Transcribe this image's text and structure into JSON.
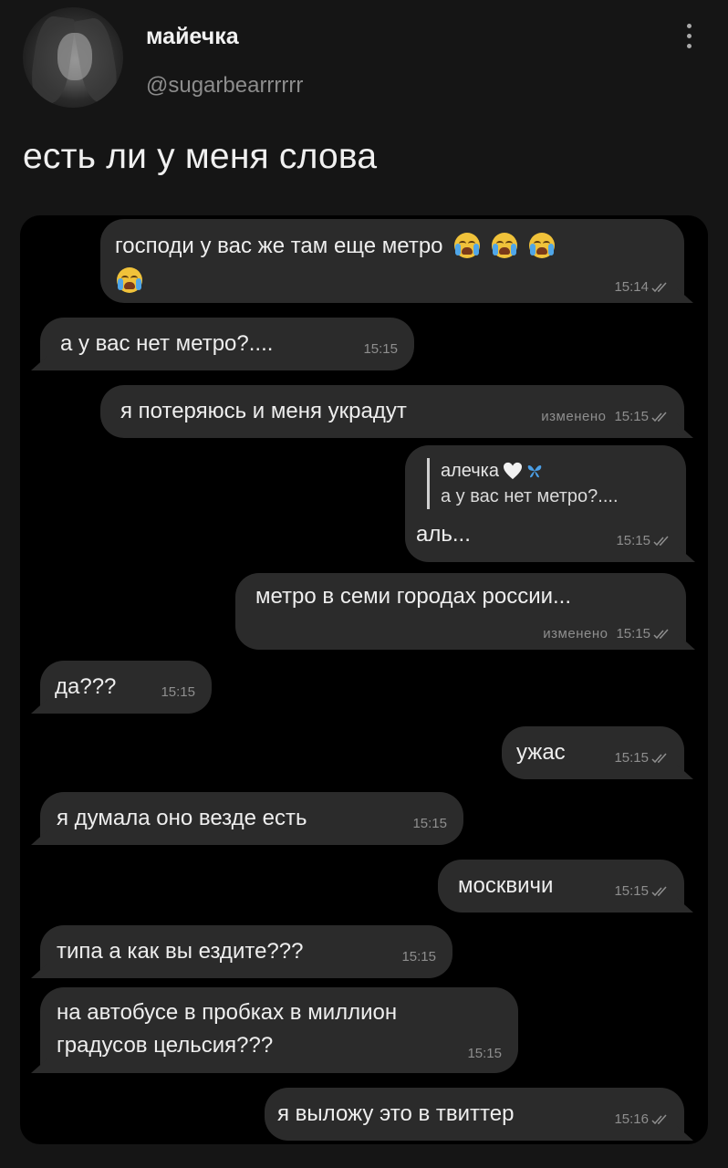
{
  "tweet": {
    "display_name": "майечка",
    "handle": "@sugarbearrrrrr",
    "text": "есть ли у меня слова"
  },
  "chat": {
    "messages": [
      {
        "side": "out",
        "text": "господи у вас же там еще метро",
        "time": "15:14"
      },
      {
        "side": "in",
        "text": "а у вас нет метро?....",
        "time": "15:15"
      },
      {
        "side": "out",
        "text": "я потеряюсь и меня украдут",
        "edited": "изменено",
        "time": "15:15"
      },
      {
        "side": "out",
        "reply_name": "алечка",
        "reply_text": "а у вас нет метро?....",
        "text": "аль...",
        "time": "15:15"
      },
      {
        "side": "out",
        "text": "метро в семи городах россии...",
        "edited": "изменено",
        "time": "15:15"
      },
      {
        "side": "in",
        "text": "да???",
        "time": "15:15"
      },
      {
        "side": "out",
        "text": "ужас",
        "time": "15:15"
      },
      {
        "side": "in",
        "text": "я думала оно везде есть",
        "time": "15:15"
      },
      {
        "side": "out",
        "text": "москвичи",
        "time": "15:15"
      },
      {
        "side": "in",
        "text": "типа а как вы ездите???",
        "time": "15:15"
      },
      {
        "side": "in",
        "text_line1": "на автобусе в пробках в миллион",
        "text_line2": "градусов цельсия???",
        "time": "15:15"
      },
      {
        "side": "out",
        "text": "я выложу это в твиттер",
        "time": "15:16"
      }
    ]
  },
  "colors": {
    "page_bg": "#151515",
    "chat_bg": "#000000",
    "bubble": "#2b2b2b",
    "meta_text": "#8e8e8e"
  },
  "icons": [
    "more-vertical-icon",
    "double-check-icon",
    "loudly-crying-face-emoji",
    "white-heart-emoji",
    "butterfly-emoji"
  ]
}
